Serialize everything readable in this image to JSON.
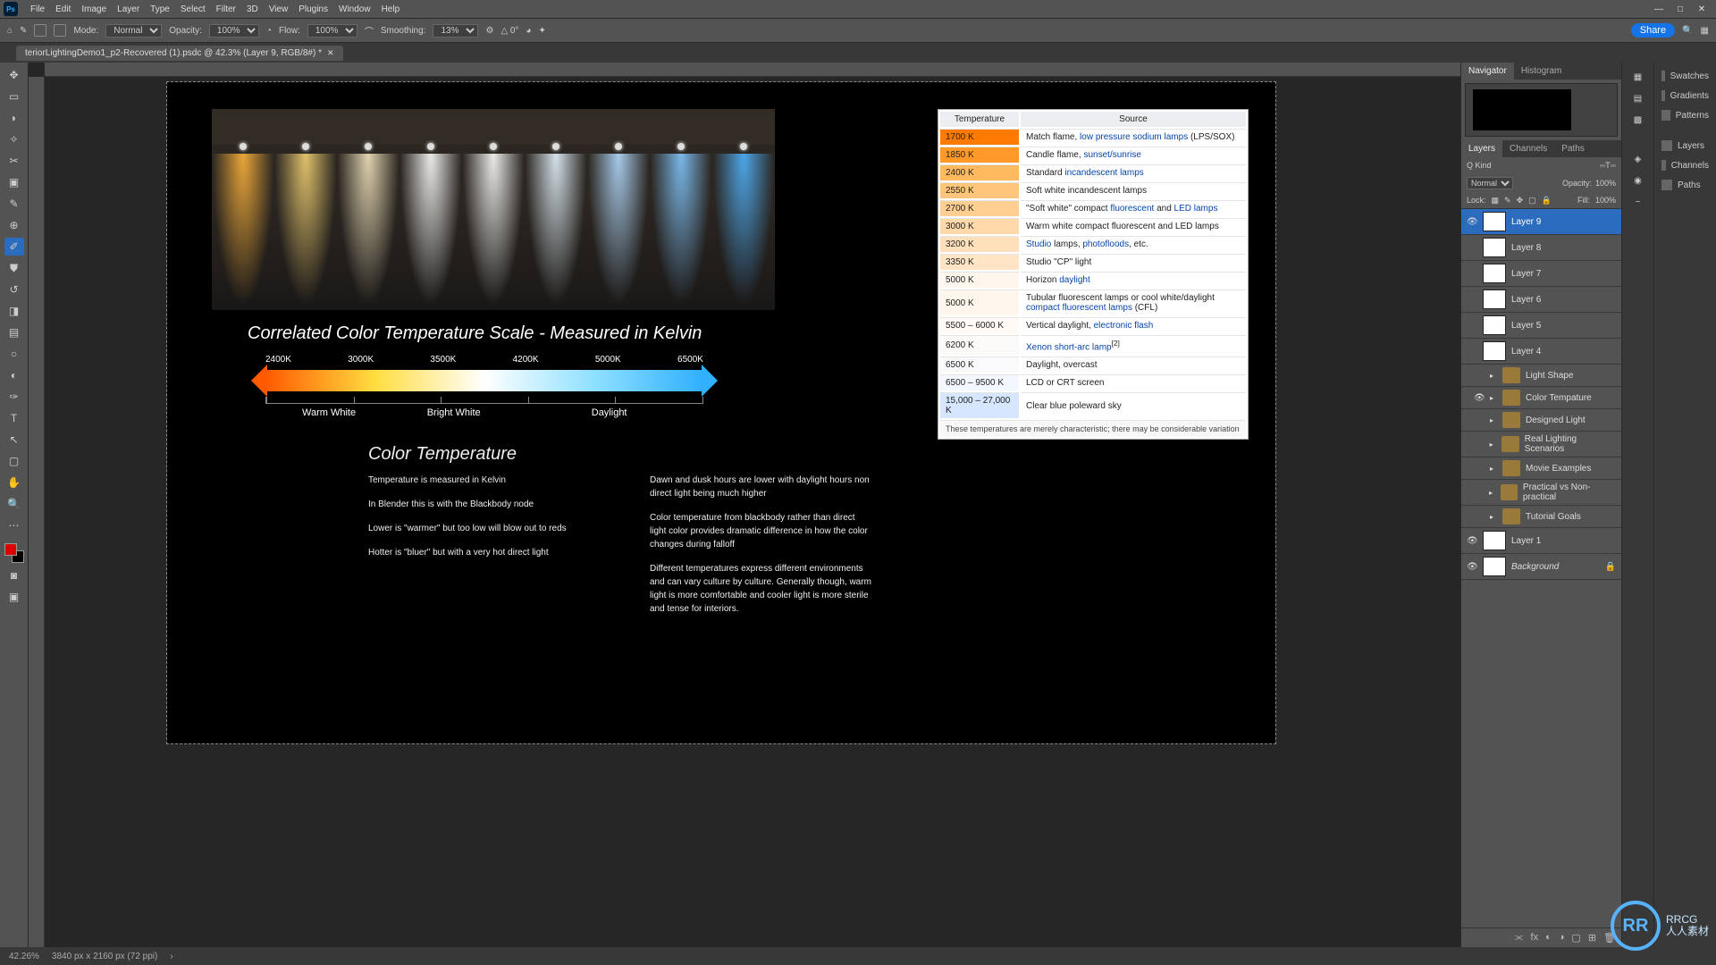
{
  "menu": {
    "items": [
      "File",
      "Edit",
      "Image",
      "Layer",
      "Type",
      "Select",
      "Filter",
      "3D",
      "View",
      "Plugins",
      "Window",
      "Help"
    ],
    "logo": "Ps"
  },
  "options": {
    "mode_lbl": "Mode:",
    "mode": "Normal",
    "opacity_lbl": "Opacity:",
    "opacity": "100%",
    "flow_lbl": "Flow:",
    "flow": "100%",
    "smooth_lbl": "Smoothing:",
    "smooth": "13%",
    "share": "Share"
  },
  "tab": {
    "title": "teriorLightingDemo1_p2-Recovered (1).psdc @ 42.3% (Layer 9, RGB/8#) *"
  },
  "doc": {
    "scale_title": "Correlated Color Temperature Scale - Measured in Kelvin",
    "scale_top": [
      "2400K",
      "3000K",
      "3500K",
      "4200K",
      "5000K",
      "6500K"
    ],
    "scale_bot": [
      "Warm White",
      "Bright White",
      "Daylight"
    ],
    "section": "Color Temperature",
    "col1": [
      "Temperature is measured in Kelvin",
      "In Blender this is with the Blackbody node",
      "Lower is \"warmer\" but too low will blow out to reds",
      "Hotter is \"bluer\" but with a very hot direct light"
    ],
    "col2": [
      "Dawn and dusk hours are lower with daylight hours non direct light being much higher",
      "Color temperature from blackbody rather than direct light color provides dramatic difference in how the color changes during falloff",
      "Different temperatures express different environments and can vary culture by culture. Generally though, warm light is more comfortable and cooler light is more sterile and tense for interiors."
    ],
    "table": {
      "header": [
        "Temperature",
        "Source"
      ],
      "rows": [
        {
          "t": "1700 K",
          "bg": "#ff7a00",
          "s": "Match flame, <a>low pressure sodium lamps</a> (LPS/SOX)"
        },
        {
          "t": "1850 K",
          "bg": "#ff9a2a",
          "s": "Candle flame, <a>sunset/sunrise</a>"
        },
        {
          "t": "2400 K",
          "bg": "#ffb95e",
          "s": "Standard <a>incandescent lamps</a>"
        },
        {
          "t": "2550 K",
          "bg": "#ffc57a",
          "s": "Soft white incandescent lamps"
        },
        {
          "t": "2700 K",
          "bg": "#ffce91",
          "s": "\"Soft white\" compact <a>fluorescent</a> and <a>LED lamps</a>"
        },
        {
          "t": "3000 K",
          "bg": "#ffd9aa",
          "s": "Warm white compact fluorescent and LED lamps"
        },
        {
          "t": "3200 K",
          "bg": "#ffe0bb",
          "s": "<a>Studio</a> lamps, <a>photofloods</a>, etc."
        },
        {
          "t": "3350 K",
          "bg": "#ffe4c5",
          "s": "Studio \"CP\" light"
        },
        {
          "t": "5000 K",
          "bg": "#fff6ed",
          "s": "Horizon <a>daylight</a>"
        },
        {
          "t": "5000 K",
          "bg": "#fff6ed",
          "s": "Tubular fluorescent lamps or cool white/daylight <a>compact fluorescent lamps</a> (CFL)"
        },
        {
          "t": "5500 – 6000 K",
          "bg": "#fffaf5",
          "s": "Vertical daylight, <a>electronic flash</a>"
        },
        {
          "t": "6200 K",
          "bg": "#fcfaf9",
          "s": "<a>Xenon short-arc lamp</a><sup>[2]</sup>"
        },
        {
          "t": "6500 K",
          "bg": "#faf9fb",
          "s": "Daylight, overcast"
        },
        {
          "t": "6500 – 9500 K",
          "bg": "#f3f7ff",
          "s": "LCD or CRT screen"
        },
        {
          "t": "15,000 – 27,000 K",
          "bg": "#d6e6ff",
          "s": "Clear blue poleward sky"
        }
      ],
      "footer": "These temperatures are merely characteristic; there may be considerable variation"
    }
  },
  "panels": {
    "nav_tabs": [
      "Navigator",
      "Histogram"
    ],
    "layer_tabs": [
      "Layers",
      "Channels",
      "Paths"
    ],
    "kind": "Q Kind",
    "blend": "Normal",
    "opac_lbl": "Opacity:",
    "opac": "100%",
    "lock": "Lock:",
    "fill_lbl": "Fill:",
    "fill": "100%",
    "layers": [
      {
        "eye": true,
        "type": "px",
        "name": "Layer 9",
        "sel": true
      },
      {
        "eye": false,
        "type": "px",
        "name": "Layer 8"
      },
      {
        "eye": false,
        "type": "px",
        "name": "Layer 7"
      },
      {
        "eye": false,
        "type": "px",
        "name": "Layer 6"
      },
      {
        "eye": false,
        "type": "px",
        "name": "Layer 5"
      },
      {
        "eye": false,
        "type": "px",
        "name": "Layer 4"
      },
      {
        "eye": false,
        "type": "grp",
        "name": "Light Shape"
      },
      {
        "eye": true,
        "type": "grp",
        "name": "Color Tempature"
      },
      {
        "eye": false,
        "type": "grp",
        "name": "Designed Light"
      },
      {
        "eye": false,
        "type": "grp",
        "name": "Real Lighting Scenarios"
      },
      {
        "eye": false,
        "type": "grp",
        "name": "Movie Examples"
      },
      {
        "eye": false,
        "type": "grp",
        "name": "Practical vs Non-practical"
      },
      {
        "eye": false,
        "type": "grp",
        "name": "Tutorial Goals"
      },
      {
        "eye": true,
        "type": "px",
        "name": "Layer 1"
      },
      {
        "eye": true,
        "type": "bg",
        "name": "Background"
      }
    ]
  },
  "side": {
    "labels": [
      "Swatches",
      "Gradients",
      "Patterns",
      "Layers",
      "Channels",
      "Paths"
    ]
  },
  "status": {
    "zoom": "42.26%",
    "dims": "3840 px x 2160 px (72 ppi)"
  },
  "watermark": {
    "logo": "RR",
    "text": "RRCG\n人人素材"
  }
}
